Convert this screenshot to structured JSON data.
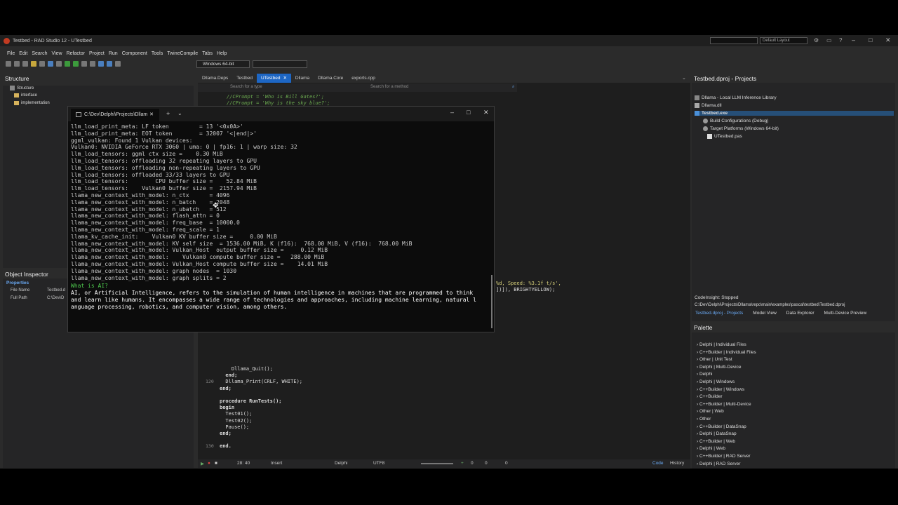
{
  "window": {
    "title": "Testbed - RAD Studio 12 - UTestbed",
    "layout": "Default Layout"
  },
  "menu": [
    "File",
    "Edit",
    "Search",
    "View",
    "Refactor",
    "Project",
    "Run",
    "Component",
    "Tools",
    "TwineCompile",
    "Tabs",
    "Help"
  ],
  "toolbar": {
    "platform": "Windows 64-bit"
  },
  "structure": {
    "title": "Structure",
    "root": "Structure",
    "items": [
      "interface",
      "implementation"
    ]
  },
  "object_inspector": {
    "title": "Object Inspector",
    "tab": "Properties",
    "rows": [
      {
        "name": "File Name",
        "value": "Testbed.d"
      },
      {
        "name": "Full Path",
        "value": "C:\\Dev\\D"
      }
    ]
  },
  "editor": {
    "tabs": [
      "Dllama.Deps",
      "Testbed",
      "UTestbed",
      "Dllama",
      "Dllama.Core",
      "exports.cpp"
    ],
    "search_type": "Search for a type",
    "search_method": "Search for a method",
    "code_top": [
      "//CPrompt = 'Who is Bill Gates?';",
      "//CPrompt = 'Why is the sky blue?';"
    ],
    "code_right": [
      "%d, Speed: %3.1f t/s',",
      "])]), BRIGHTYELLOW);"
    ],
    "code_bottom": [
      {
        "num": "",
        "text": "    Dllama_Quit();"
      },
      {
        "num": "",
        "text": "  end;"
      },
      {
        "num": "120",
        "text": "  Dllama_Print(CRLF, WHITE);"
      },
      {
        "num": "",
        "text": "end;"
      },
      {
        "num": "",
        "text": ""
      },
      {
        "num": "",
        "text": "procedure RunTests();"
      },
      {
        "num": "",
        "text": "begin"
      },
      {
        "num": "",
        "text": "  Test01();"
      },
      {
        "num": "",
        "text": "  Test02();"
      },
      {
        "num": "",
        "text": "  Pause();"
      },
      {
        "num": "",
        "text": "end;"
      },
      {
        "num": "",
        "text": ""
      },
      {
        "num": "130",
        "text": "end."
      }
    ]
  },
  "status": {
    "position": "28: 40",
    "mode": "Insert",
    "language": "Delphi",
    "encoding": "UTF8",
    "counts": [
      "0",
      "0",
      "0"
    ],
    "tab_code": "Code",
    "tab_history": "History"
  },
  "projects": {
    "title": "Testbed.dproj - Projects",
    "group": "Dllama - Local LLM Inference Library",
    "dll": "Dllama.dll",
    "exe": "Testbed.exe",
    "build_configs": "Build Configurations (Debug)",
    "target_platforms": "Target Platforms (Windows 64-bit)",
    "unit": "UTestbed.pas",
    "codeinsight": "CodeInsight: Stopped",
    "path": "C:\\Dev\\Delphi\\Projects\\Dllama\\repo\\main\\examples\\pascal\\testbed\\Testbed.dproj",
    "tabs": [
      "Testbed.dproj - Projects",
      "Model View",
      "Data Explorer",
      "Multi-Device Preview"
    ]
  },
  "palette": {
    "title": "Palette",
    "items": [
      "Delphi | Individual Files",
      "C++Builder | Individual Files",
      "Other | Unit Test",
      "Delphi | Multi-Device",
      "Delphi",
      "Delphi | Windows",
      "C++Builder | Windows",
      "C++Builder",
      "C++Builder | Multi-Device",
      "Other | Web",
      "Other",
      "C++Builder | DataSnap",
      "Delphi | DataSnap",
      "C++Builder | Web",
      "Delphi | Web",
      "C++Builder | RAD Server",
      "Delphi | RAD Server"
    ]
  },
  "terminal": {
    "tab_title": "C:\\Dev\\Delphi\\Projects\\Dllam",
    "lines": [
      "llm_load_print_meta: LF token         = 13 '<0x0A>'",
      "llm_load_print_meta: EOT token        = 32007 '<|end|>'",
      "ggml_vulkan: Found 1 Vulkan devices:",
      "Vulkan0: NVIDIA GeForce RTX 3060 | uma: 0 | fp16: 1 | warp size: 32",
      "llm_load_tensors: ggml ctx size =    0.30 MiB",
      "llm_load_tensors: offloading 32 repeating layers to GPU",
      "llm_load_tensors: offloading non-repeating layers to GPU",
      "llm_load_tensors: offloaded 33/33 layers to GPU",
      "llm_load_tensors:        CPU buffer size =    52.84 MiB",
      "llm_load_tensors:    Vulkan0 buffer size =  2157.94 MiB",
      "llama_new_context_with_model: n_ctx      = 4096",
      "llama_new_context_with_model: n_batch    = 2048",
      "llama_new_context_with_model: n_ubatch   = 512",
      "llama_new_context_with_model: flash_attn = 0",
      "llama_new_context_with_model: freq_base  = 10000.0",
      "llama_new_context_with_model: freq_scale = 1",
      "llama_kv_cache_init:    Vulkan0 KV buffer size =     0.00 MiB",
      "llama_new_context_with_model: KV self size  = 1536.00 MiB, K (f16):  768.00 MiB, V (f16):  768.00 MiB",
      "llama_new_context_with_model: Vulkan_Host  output buffer size =     0.12 MiB",
      "llama_new_context_with_model:    Vulkan0 compute buffer size =   288.00 MiB",
      "llama_new_context_with_model: Vulkan_Host compute buffer size =    14.01 MiB",
      "llama_new_context_with_model: graph nodes  = 1030",
      "llama_new_context_with_model: graph splits = 2"
    ],
    "prompt": "What is AI?",
    "answer": [
      "AI, or Artificial Intelligence, refers to the simulation of human intelligence in machines that are programmed to think",
      "and learn like humans. It encompasses a wide range of technologies and approaches, including machine learning, natural l",
      "anguage processing, robotics, and computer vision, among others."
    ]
  }
}
